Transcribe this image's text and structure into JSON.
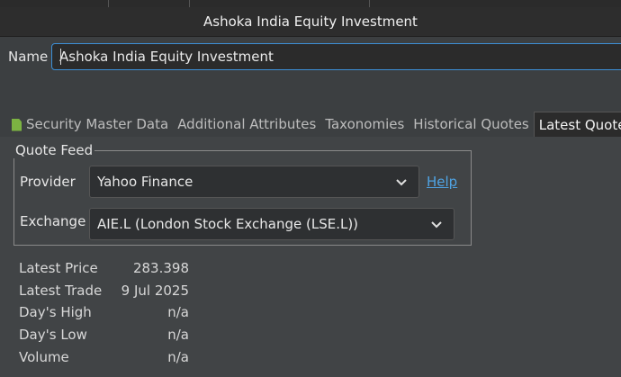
{
  "window": {
    "title": "Ashoka India Equity Investment"
  },
  "name_field": {
    "label": "Name",
    "value": "Ashoka India Equity Investment"
  },
  "tabs": [
    {
      "label": "Security Master Data",
      "icon": "document-icon"
    },
    {
      "label": "Additional Attributes"
    },
    {
      "label": "Taxonomies"
    },
    {
      "label": "Historical Quotes"
    },
    {
      "label": "Latest Quote",
      "active": true
    }
  ],
  "quote_feed": {
    "legend": "Quote Feed",
    "provider_label": "Provider",
    "provider_value": "Yahoo Finance",
    "help_link": "Help",
    "exchange_label": "Exchange",
    "exchange_value": "AIE.L (London Stock Exchange (LSE.L))"
  },
  "latest": {
    "price_label": "Latest Price",
    "price_value": "283.398",
    "trade_label": "Latest Trade",
    "trade_value": "9 Jul 2025",
    "high_label": "Day's High",
    "high_value": "n/a",
    "low_label": "Day's Low",
    "low_value": "n/a",
    "volume_label": "Volume",
    "volume_value": "n/a"
  },
  "colors": {
    "accent": "#3d8fd6",
    "link": "#4fa3e3",
    "icon_green": "#7cb342"
  }
}
